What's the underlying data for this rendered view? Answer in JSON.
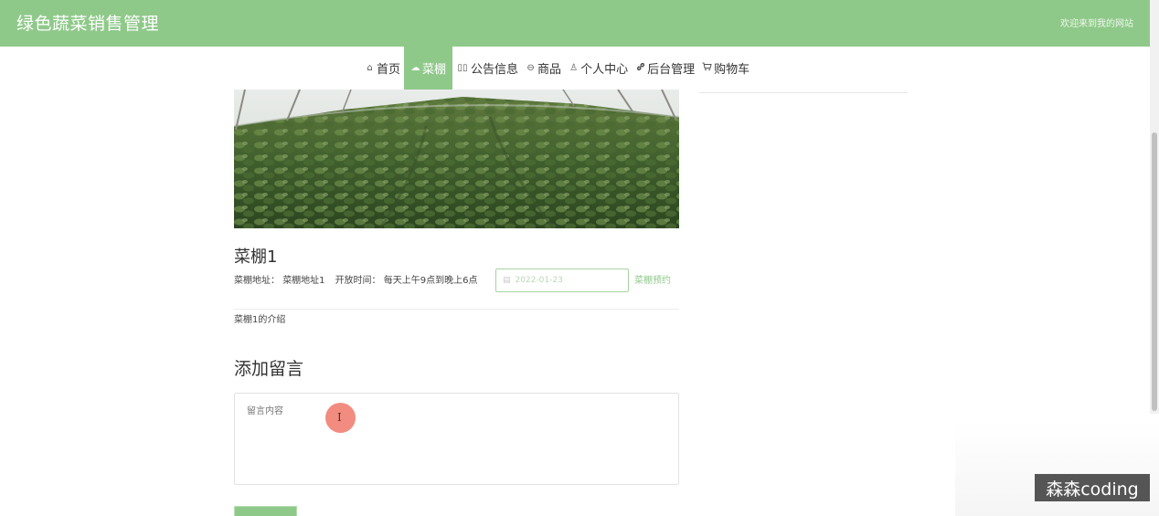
{
  "header": {
    "site_title": "绿色蔬菜销售管理",
    "welcome": "欢迎来到我的网站",
    "bg_color": "#8fc98a"
  },
  "nav": {
    "items": [
      {
        "icon": "home-icon",
        "glyph": "⌂",
        "label": "首页",
        "active": false
      },
      {
        "icon": "cloud-icon",
        "glyph": "☁",
        "label": "菜棚",
        "active": true
      },
      {
        "icon": "columns-icon",
        "glyph": "▯▯",
        "label": "公告信息",
        "active": false
      },
      {
        "icon": "circle-minus-icon",
        "glyph": "⊖",
        "label": "商品",
        "active": false
      },
      {
        "icon": "user-icon",
        "glyph": "♙",
        "label": "个人中心",
        "active": false
      },
      {
        "icon": "link-icon",
        "glyph": "🔗",
        "label": "后台管理",
        "active": false
      },
      {
        "icon": "cart-icon",
        "glyph": "🛒",
        "label": "购物车",
        "active": false
      }
    ]
  },
  "detail": {
    "name": "菜棚1",
    "address_label": "菜棚地址：",
    "address": "菜棚地址1",
    "hours_label": "开放时间：",
    "hours": "每天上午9点到晚上6点",
    "date_value": "2022-01-23",
    "reserve_label": "菜棚预约",
    "intro": "菜棚1的介绍"
  },
  "comment": {
    "section_title": "添加留言",
    "placeholder": "留言内容"
  },
  "watermark": "森森coding",
  "accent_color": "#8fc98a"
}
